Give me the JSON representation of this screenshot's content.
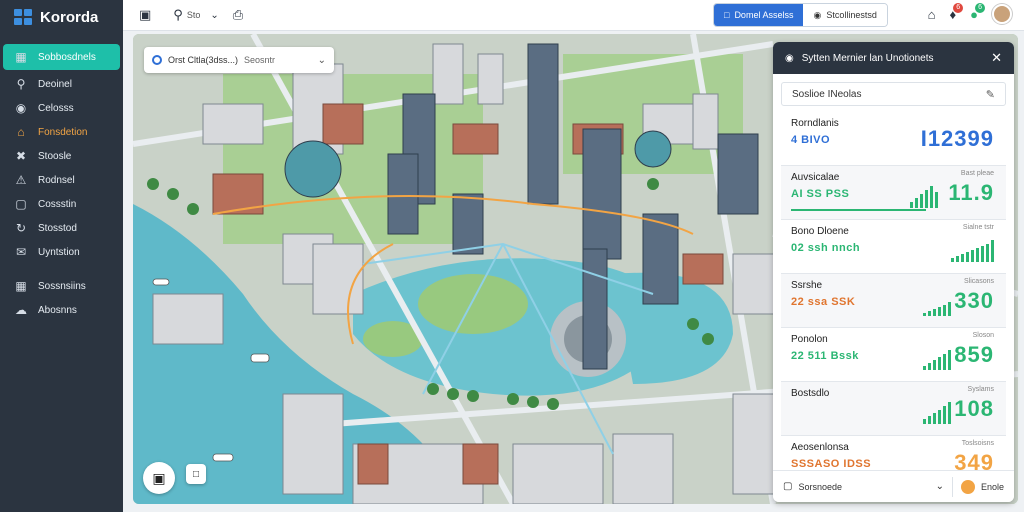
{
  "app": {
    "name": "Kororda"
  },
  "sidebar": {
    "items": [
      {
        "label": "Sobbosdnels",
        "icon": "dashboard-icon",
        "active": true
      },
      {
        "label": "Deoinel",
        "icon": "search-icon"
      },
      {
        "label": "Celosss",
        "icon": "location-icon"
      },
      {
        "label": "Fonsdetion",
        "icon": "building-icon",
        "accent": true
      },
      {
        "label": "Stoosle",
        "icon": "wrench-icon"
      },
      {
        "label": "Rodnsel",
        "icon": "alert-icon"
      },
      {
        "label": "Cossstin",
        "icon": "doc-icon"
      },
      {
        "label": "Stosstod",
        "icon": "route-icon"
      },
      {
        "label": "Uyntstion",
        "icon": "chat-icon"
      },
      {
        "label": "Sossnsiins",
        "icon": "grid-icon"
      },
      {
        "label": "Abosnns",
        "icon": "cloud-icon"
      }
    ]
  },
  "topbar": {
    "tool_label": "Sto",
    "seg_on": "Domel Asselss",
    "seg_off": "Stcollinestsd",
    "badge1": "6",
    "badge2": "6"
  },
  "map": {
    "search_text": "Orst Cltla(3dss...)",
    "search_sub": "Seosntr"
  },
  "panel": {
    "title": "Sytten Mernier lan Unotionets",
    "search": "Soslioe INeolas",
    "metrics": [
      {
        "title": "Rorndlanis",
        "sub": "4 BIVO",
        "cap": "",
        "value": "I12399",
        "sub_color": "#2f6fd6",
        "val_color": "#2f6fd6"
      },
      {
        "title": "Auvsicalae",
        "sub": "AI SS PSS",
        "cap": "Bast pleae",
        "value": "11.9",
        "sub_color": "#2bb673",
        "val_color": "#2bb673"
      },
      {
        "title": "Bono Dloene",
        "sub": "02 ssh nnch",
        "cap": "Sialne tstr",
        "value": "",
        "sub_color": "#2bb673",
        "val_color": "#2bb673"
      },
      {
        "title": "Ssrshe",
        "sub": "22 ssa SSK",
        "cap": "Slicasons",
        "value": "330",
        "sub_color": "#e0752f",
        "val_color": "#2bb673"
      },
      {
        "title": "Ponolon",
        "sub": "22 511 Bssk",
        "cap": "Sloson",
        "value": "859",
        "sub_color": "#2bb673",
        "val_color": "#2bb673"
      },
      {
        "title": "Bostsdlo",
        "sub": "",
        "cap": "Syslams",
        "value": "108",
        "sub_color": "#2bb673",
        "val_color": "#2bb673"
      },
      {
        "title": "Aeosenlonsa",
        "sub": "SSSASO IDSS",
        "cap": "Toslsoisns",
        "value": "349",
        "sub_color": "#e0752f",
        "val_color": "#f2a444"
      }
    ],
    "footer_left": "Sorsnoede",
    "footer_right": "Enole"
  }
}
